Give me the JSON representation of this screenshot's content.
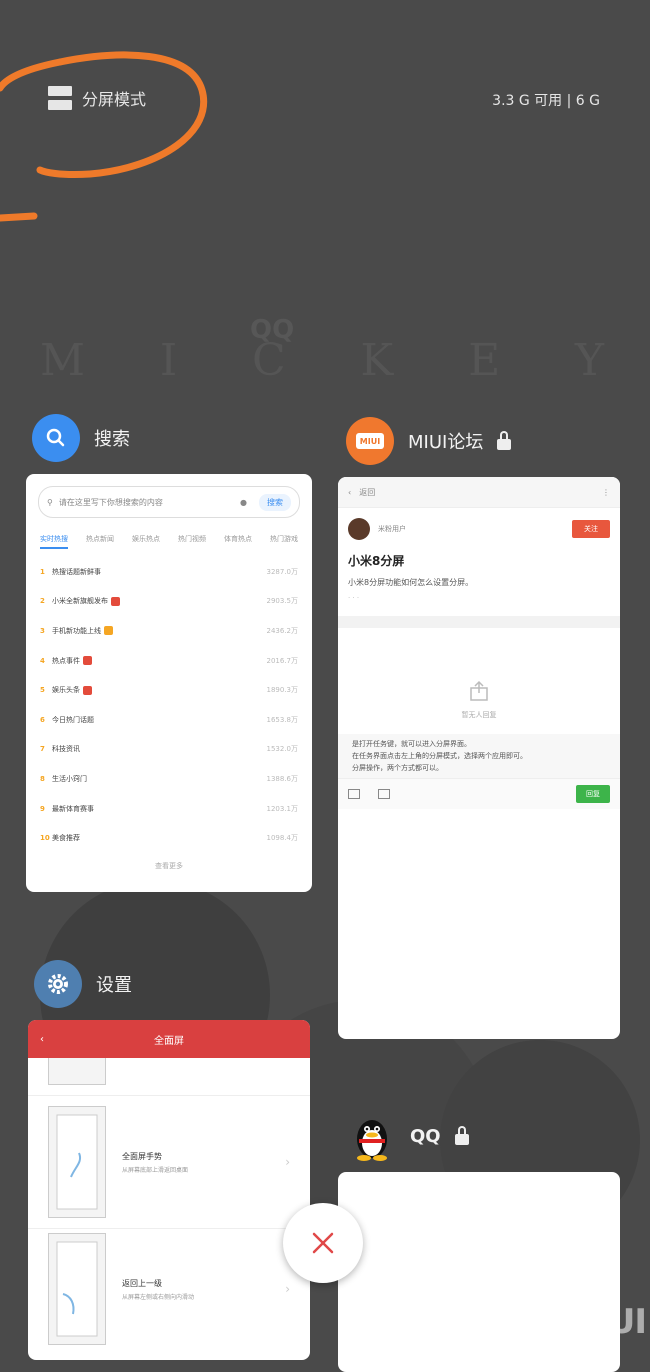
{
  "top": {
    "split_label": "分屏模式",
    "memory": "3.3 G 可用 | 6 G"
  },
  "wallpaper": {
    "letters": [
      "M",
      "I",
      "C",
      "K",
      "E",
      "Y"
    ],
    "small": "QQ"
  },
  "apps": {
    "search": {
      "name": "搜索",
      "placeholder": "请在这里写下你想搜索的内容",
      "button": "搜索",
      "tabs": [
        "实时热搜",
        "热点新闻",
        "娱乐热点",
        "热门视频",
        "体育热点",
        "热门游戏"
      ],
      "items": [
        {
          "rank": "1",
          "title": "热搜话题新鲜事",
          "tag": "",
          "value": "3287.0万"
        },
        {
          "rank": "2",
          "title": "小米全新旗舰发布",
          "tag": "热",
          "value": "2903.5万"
        },
        {
          "rank": "3",
          "title": "手机新功能上线",
          "tag": "新",
          "value": "2436.2万"
        },
        {
          "rank": "4",
          "title": "热点事件",
          "tag": "热",
          "value": "2016.7万"
        },
        {
          "rank": "5",
          "title": "娱乐头条",
          "tag": "热",
          "value": "1890.3万"
        },
        {
          "rank": "6",
          "title": "今日热门话题",
          "tag": "",
          "value": "1653.8万"
        },
        {
          "rank": "7",
          "title": "科技资讯",
          "tag": "",
          "value": "1532.0万"
        },
        {
          "rank": "8",
          "title": "生活小窍门",
          "tag": "",
          "value": "1388.6万"
        },
        {
          "rank": "9",
          "title": "最新体育赛事",
          "tag": "",
          "value": "1203.1万"
        },
        {
          "rank": "10",
          "title": "美食推荐",
          "tag": "",
          "value": "1098.4万"
        }
      ],
      "more": "查看更多"
    },
    "miui": {
      "name": "MIUI论坛",
      "back": "返回",
      "user": "米粉用户",
      "follow": "关注",
      "title": "小米8分屏",
      "text": "小米8分屏功能如何怎么设置分屏。",
      "meta": "· · ·",
      "empty": "暂无人回复",
      "comment_line1": "是打开任务键，就可以进入分屏界面。",
      "comment_line2": "在任务界面点击左上角的分屏模式，选择两个应用即可。",
      "comment_line3": "分屏操作，两个方式都可以。",
      "send": "回复"
    },
    "settings": {
      "name": "设置",
      "title": "全面屏",
      "rows": [
        {
          "title": "全面屏手势",
          "subtitle": "从屏幕底部上滑返回桌面"
        },
        {
          "title": "返回上一级",
          "subtitle": "从屏幕左侧或右侧向内滑动"
        }
      ]
    },
    "qq": {
      "name": "QQ"
    }
  },
  "watermark": "MIUI",
  "colors": {
    "background": "#4a4a4a",
    "search_accent": "#3b8ef0",
    "miui_orange": "#f0782e",
    "settings_red": "#d94040",
    "settings_icon": "#4f7fb0",
    "close_red": "#e04848"
  }
}
